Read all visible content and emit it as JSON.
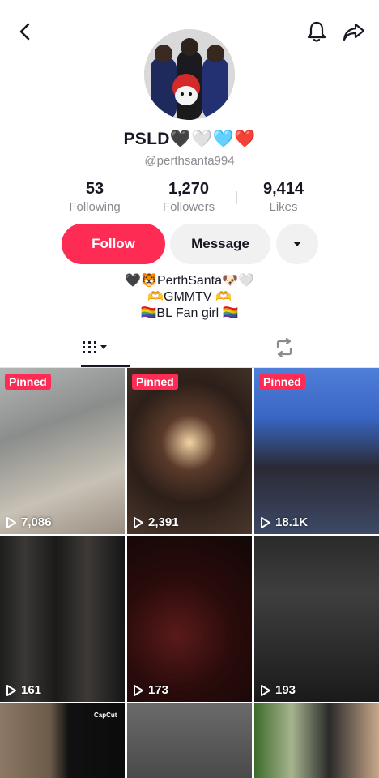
{
  "icons": {
    "back": "chevron-left-icon",
    "bell": "bell-icon",
    "share": "share-arrow-icon",
    "more": "caret-down-icon",
    "grid": "grid-icon",
    "repost": "repost-icon",
    "play": "play-icon"
  },
  "profile": {
    "display_name": "PSLD🖤🤍🩵❤️",
    "handle": "@perthsanta994"
  },
  "stats": [
    {
      "value": "53",
      "label": "Following"
    },
    {
      "value": "1,270",
      "label": "Followers"
    },
    {
      "value": "9,414",
      "label": "Likes"
    }
  ],
  "actions": {
    "follow": "Follow",
    "message": "Message"
  },
  "bio": [
    "🖤🐯PerthSanta🐶🤍",
    "🫶GMMTV 🫶",
    "🏳️‍🌈BL Fan girl 🏳️‍🌈"
  ],
  "videos": [
    {
      "pinned": "Pinned",
      "views": "7,086"
    },
    {
      "pinned": "Pinned",
      "views": "2,391"
    },
    {
      "pinned": "Pinned",
      "views": "18.1K"
    },
    {
      "views": "161"
    },
    {
      "views": "173"
    },
    {
      "views": "193"
    },
    {
      "overlay": "CapCut"
    },
    {},
    {}
  ],
  "colors": {
    "accent": "#fe2c55",
    "secondary_button": "#f1f1f2",
    "muted_text": "#8a8b91"
  }
}
